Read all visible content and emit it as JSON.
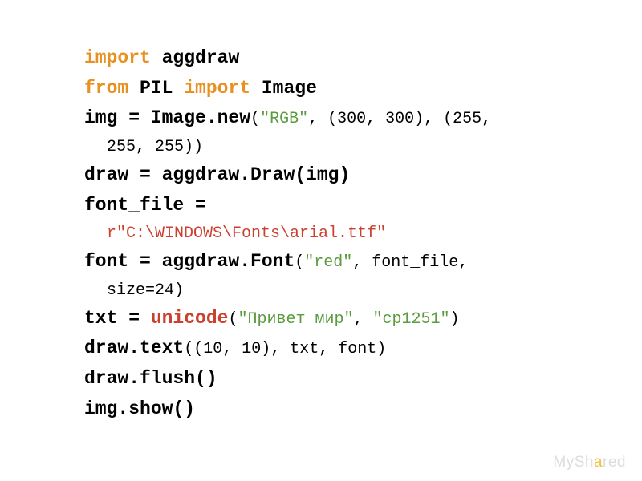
{
  "code": {
    "l1_import": "import",
    "l1_aggdraw": " aggdraw",
    "l2_from": "from",
    "l2_pil": " PIL ",
    "l2_import": "import",
    "l2_image": " Image",
    "l3_part1": "img = Image.new",
    "l3_part2": "(",
    "l3_str": "\"RGB\"",
    "l3_part3": ", (300, 300), (255,",
    "l3b": "255, 255))",
    "l4": "draw = aggdraw.Draw(img)",
    "l5": "font_file =",
    "l5b_prefix": "r",
    "l5b_str": "\"C:\\WINDOWS\\Fonts\\arial.ttf\"",
    "l6_part1": "font = aggdraw.Font",
    "l6_part2": "(",
    "l6_str": "\"red\"",
    "l6_part3": ", font_file,",
    "l6b": "size=24)",
    "l7_part1": "txt = ",
    "l7_unicode": "unicode",
    "l7_part2": "(",
    "l7_str1": "\"Привет мир\"",
    "l7_comma": ", ",
    "l7_str2": "\"cp1251\"",
    "l7_part3": ")",
    "l8_part1": "draw.text",
    "l8_part2": "((10, 10), txt, font)",
    "l9": "draw.flush()",
    "l10": "img.show()"
  },
  "watermark": {
    "text1": "MySh",
    "accent": "a",
    "text2": "red"
  }
}
